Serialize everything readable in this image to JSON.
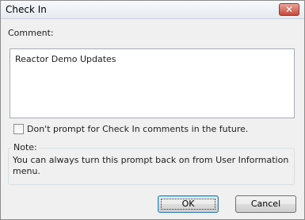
{
  "window": {
    "title": "Check In",
    "close_icon": "close-icon"
  },
  "form": {
    "comment_label": "Comment:",
    "comment_value": "Reactor Demo Updates",
    "checkbox_label": "Don't prompt for Check In comments in the future.",
    "checkbox_checked": false
  },
  "note": {
    "legend": "Note:",
    "text": "You can always turn this prompt back on from User Information menu."
  },
  "buttons": {
    "ok_label": "OK",
    "cancel_label": "Cancel"
  },
  "colors": {
    "close_button": "#c74a3b",
    "default_button_border": "#3c7fb1"
  }
}
